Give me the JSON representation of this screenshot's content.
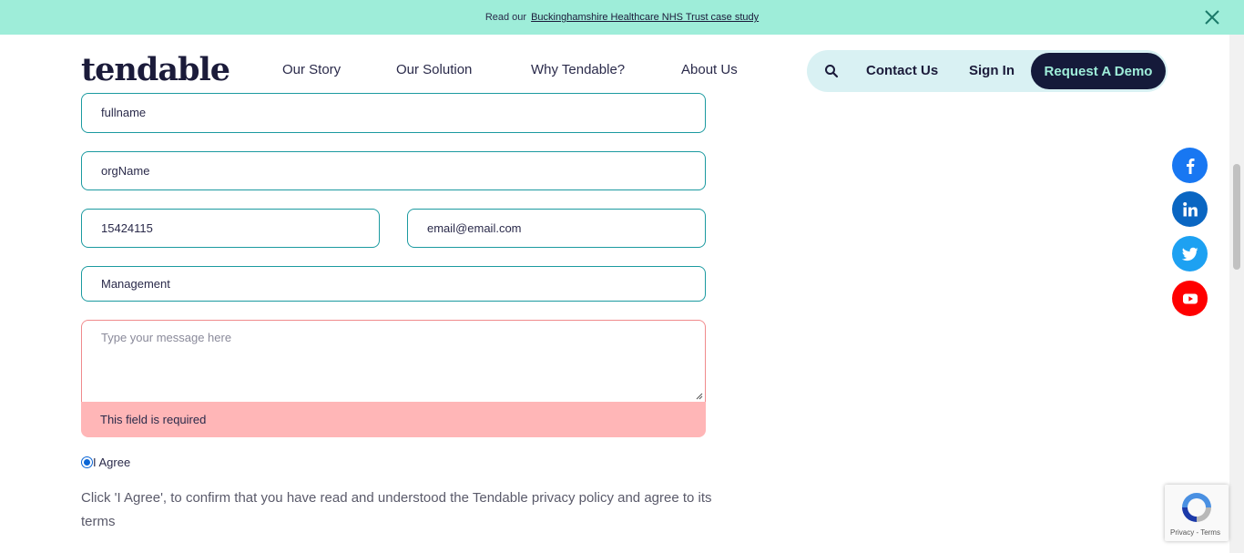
{
  "banner": {
    "lead": "Read our",
    "link": "Buckinghamshire Healthcare NHS Trust case study"
  },
  "header": {
    "logo": "tendable",
    "nav": [
      "Our Story",
      "Our Solution",
      "Why Tendable?",
      "About Us"
    ],
    "contact": "Contact Us",
    "signin": "Sign In",
    "demo": "Request A Demo"
  },
  "form": {
    "fullname": "fullname",
    "org": "orgName",
    "phone": "15424115",
    "email": "email@email.com",
    "department": "Management",
    "message_placeholder": "Type your message here",
    "error": "This field is required",
    "agree_label": "I Agree",
    "consent": "Click 'I Agree', to confirm that you have read and understood the Tendable privacy policy and agree to its terms"
  },
  "recaptcha": {
    "text": "Privacy - Terms"
  },
  "colors": {
    "banner": "#9eedd9",
    "navy": "#151a3a",
    "field_border": "#1b9aa0",
    "error_bg": "#ffb6b7",
    "facebook": "#1877f2",
    "linkedin": "#0a66c2",
    "twitter": "#1da1f2",
    "youtube": "#ff0000"
  }
}
